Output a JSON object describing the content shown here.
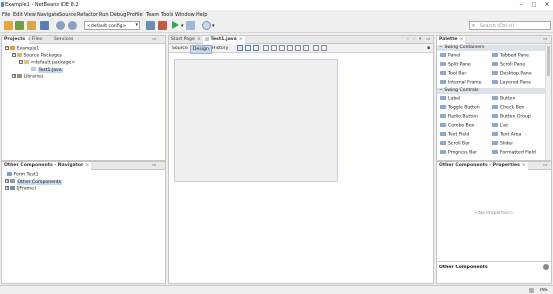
{
  "window": {
    "title": "Example1 - NetBeans IDE 8.2"
  },
  "menubar": [
    "File",
    "Edit",
    "View",
    "Navigate",
    "Source",
    "Refactor",
    "Run",
    "Debug",
    "Profile",
    "Team",
    "Tools",
    "Window",
    "Help"
  ],
  "toolbar": {
    "config_value": "<default config>",
    "search_placeholder": "Search (Ctrl+I)"
  },
  "projects_panel": {
    "tabs": [
      "Projects",
      "Files",
      "Services"
    ],
    "tree": {
      "root": "Example1",
      "source_packages": "Source Packages",
      "default_package": "<default package>",
      "file": "Test1.java",
      "libraries": "Libraries"
    }
  },
  "navigator_panel": {
    "title": "Other Components - Navigator",
    "tree": {
      "root": "Form Test1",
      "other_components": "Other Components",
      "jframe": "[JFrame]"
    }
  },
  "editor": {
    "tabs": [
      "Start Page",
      "Test1.java"
    ],
    "subtabs": [
      "Source",
      "Design",
      "History"
    ]
  },
  "palette_panel": {
    "title": "Palette",
    "categories": [
      {
        "name": "Swing Containers",
        "items": [
          "Panel",
          "Tabbed Pane",
          "Split Pane",
          "Scroll Pane",
          "Tool Bar",
          "Desktop Pane",
          "Internal Frame",
          "Layered Pane"
        ]
      },
      {
        "name": "Swing Controls",
        "items": [
          "Label",
          "Button",
          "Toggle Button",
          "Check Box",
          "Radio Button",
          "Button Group",
          "Combo Box",
          "List",
          "Text Field",
          "Text Area",
          "Scroll Bar",
          "Slider",
          "Progress Bar",
          "Formatted Field"
        ]
      }
    ]
  },
  "properties_panel": {
    "title": "Other Components - Properties",
    "empty_text": "<No Properties>",
    "footer": "Other Components"
  },
  "statusbar": {
    "mode": "INS"
  },
  "colors": {
    "titlebar": "#ffffff",
    "panel_border": "#c7c7c7",
    "selection": "#c8d8ec",
    "palette_category": "#dde3ea"
  }
}
